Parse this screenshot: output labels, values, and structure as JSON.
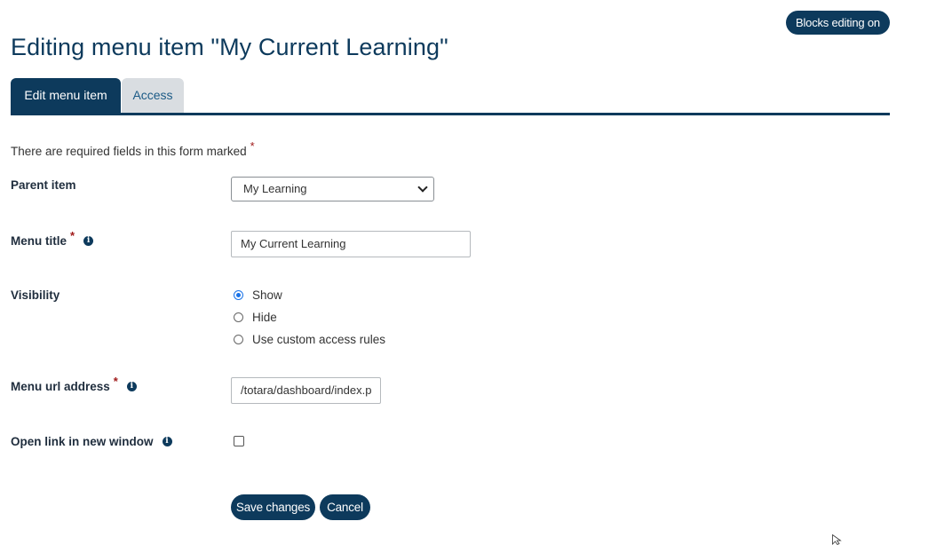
{
  "header": {
    "blocks_editing_label": "Blocks editing on",
    "page_title": "Editing menu item \"My Current Learning\""
  },
  "tabs": [
    {
      "label": "Edit menu item",
      "active": true
    },
    {
      "label": "Access",
      "active": false
    }
  ],
  "form": {
    "required_note": "There are required fields in this form marked",
    "required_marker": "*",
    "parent_item": {
      "label": "Parent item",
      "selected": "My Learning"
    },
    "menu_title": {
      "label": "Menu title",
      "value": "My Current Learning"
    },
    "visibility": {
      "label": "Visibility",
      "options": [
        {
          "label": "Show",
          "checked": true
        },
        {
          "label": "Hide",
          "checked": false
        },
        {
          "label": "Use custom access rules",
          "checked": false
        }
      ]
    },
    "menu_url": {
      "label": "Menu url address",
      "value": "/totara/dashboard/index.p"
    },
    "open_new_window": {
      "label": "Open link in new window",
      "checked": false
    },
    "buttons": {
      "save": "Save changes",
      "cancel": "Cancel"
    }
  },
  "icons": {
    "info": "info-icon",
    "chevron": "chevron-down-icon",
    "cursor": "mouse-pointer-icon"
  },
  "colors": {
    "primary": "#0d3a5c",
    "tab_inactive": "#d9dde1",
    "required": "#a01a1a",
    "radio_checked": "#1a73e8"
  }
}
